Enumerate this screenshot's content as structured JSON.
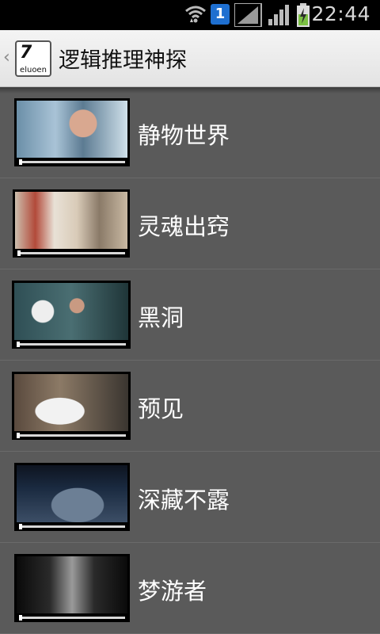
{
  "status_bar": {
    "time": "22:44",
    "notification_badge": "1",
    "icons": [
      "wifi-icon",
      "sim-card-icon",
      "signal-icon",
      "signal-icon",
      "battery-charging-icon"
    ]
  },
  "action_bar": {
    "back_glyph": "‹",
    "logo_mark": "7",
    "logo_word": "eluoen",
    "title": "逻辑推理神探"
  },
  "movies": [
    {
      "title": "静物世界"
    },
    {
      "title": "灵魂出窍"
    },
    {
      "title": "黑洞"
    },
    {
      "title": "预见"
    },
    {
      "title": "深藏不露"
    },
    {
      "title": "梦游者"
    }
  ]
}
